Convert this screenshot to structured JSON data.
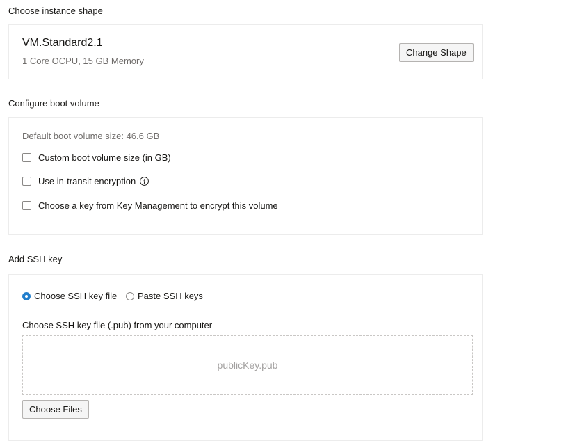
{
  "shape_section": {
    "title": "Choose instance shape",
    "shape_name": "VM.Standard2.1",
    "shape_desc": "1 Core OCPU, 15 GB Memory",
    "change_button": "Change Shape"
  },
  "boot_section": {
    "title": "Configure boot volume",
    "default_size": "Default boot volume size: 46.6 GB",
    "options": [
      {
        "label": "Custom boot volume size (in GB)",
        "checked": false
      },
      {
        "label": "Use in-transit encryption",
        "checked": false,
        "icon": "info-icon"
      },
      {
        "label": "Choose a key from Key Management to encrypt this volume",
        "checked": false
      }
    ]
  },
  "ssh_section": {
    "title": "Add SSH key",
    "radio_options": [
      {
        "label": "Choose SSH key file",
        "selected": true
      },
      {
        "label": "Paste SSH keys",
        "selected": false
      }
    ],
    "file_label": "Choose SSH key file (.pub) from your computer",
    "dropzone_text": "publicKey.pub",
    "choose_files_button": "Choose Files"
  },
  "colors": {
    "accent": "#227ecc",
    "text": "#161513",
    "muted_text": "#6f6c6a",
    "panel_border": "#ececec"
  }
}
